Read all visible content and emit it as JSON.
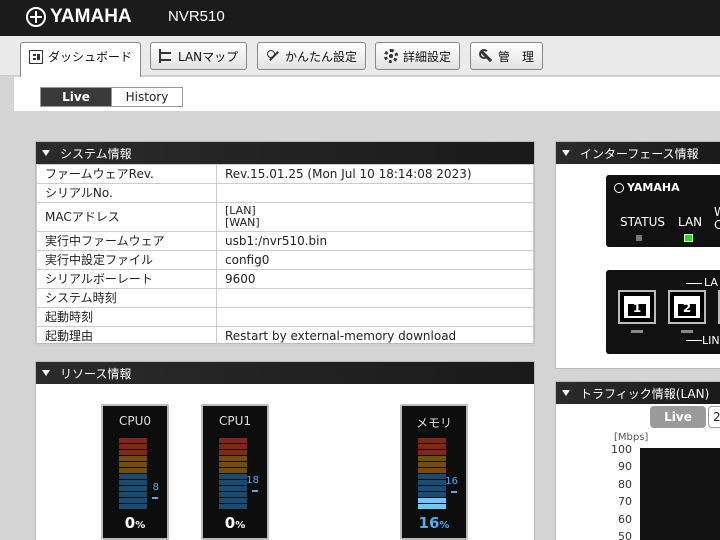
{
  "header": {
    "brand": "YAMAHA",
    "model": "NVR510"
  },
  "nav": {
    "tabs": [
      {
        "label": "ダッシュボード",
        "icon": "dashboard-icon",
        "active": true
      },
      {
        "label": "LANマップ",
        "icon": "lan-map-icon"
      },
      {
        "label": "かんたん設定",
        "icon": "wand-icon"
      },
      {
        "label": "詳細設定",
        "icon": "gear-icon"
      },
      {
        "label": "管　理",
        "icon": "wrench-icon"
      }
    ]
  },
  "view_toggle": {
    "live": "Live",
    "history": "History",
    "selected": "Live"
  },
  "system_info": {
    "title": "システム情報",
    "rows": [
      {
        "key": "ファームウェアRev.",
        "value": "Rev.15.01.25 (Mon Jul 10 18:14:08 2023)"
      },
      {
        "key": "シリアルNo.",
        "value": ""
      },
      {
        "key": "MACアドレス",
        "value_lan": "[LAN]",
        "value_wan": "[WAN]"
      },
      {
        "key": "実行中ファームウェア",
        "value": "usb1:/nvr510.bin"
      },
      {
        "key": "実行中設定ファイル",
        "value": "config0"
      },
      {
        "key": "シリアルボーレート",
        "value": "9600"
      },
      {
        "key": "システム時刻",
        "value": ""
      },
      {
        "key": "起動時刻",
        "value": ""
      },
      {
        "key": "起動理由",
        "value": "Restart by external-memory download"
      }
    ]
  },
  "resource_info": {
    "title": "リソース情報",
    "gauges": [
      {
        "label": "CPU0",
        "value": "0",
        "unit": "%",
        "peak": "8",
        "peak_fraction": 0.08
      },
      {
        "label": "CPU1",
        "value": "0",
        "unit": "%",
        "peak": "18",
        "peak_fraction": 0.18
      },
      {
        "label": "メモリ",
        "value": "16",
        "unit": "%",
        "peak": "16",
        "peak_fraction": 0.16
      }
    ]
  },
  "interface_info": {
    "title": "インターフェース情報",
    "device_logo": "YAMAHA",
    "status_label": "STATUS",
    "lan_label": "LAN",
    "partial_label_top": "W",
    "partial_label_bottom": "C",
    "lan_banner": "LA",
    "lan_banner_bottom": "LIN",
    "ports": [
      "1",
      "2"
    ],
    "colors": {
      "lan_led": "#39d12b",
      "status_led": "#777777"
    }
  },
  "traffic_info": {
    "title": "トラフィック情報(LAN)",
    "live_button": "Live",
    "next_button": "2",
    "unit": "[Mbps]",
    "y_ticks": [
      "100",
      "90",
      "80",
      "70",
      "60",
      "50"
    ]
  }
}
